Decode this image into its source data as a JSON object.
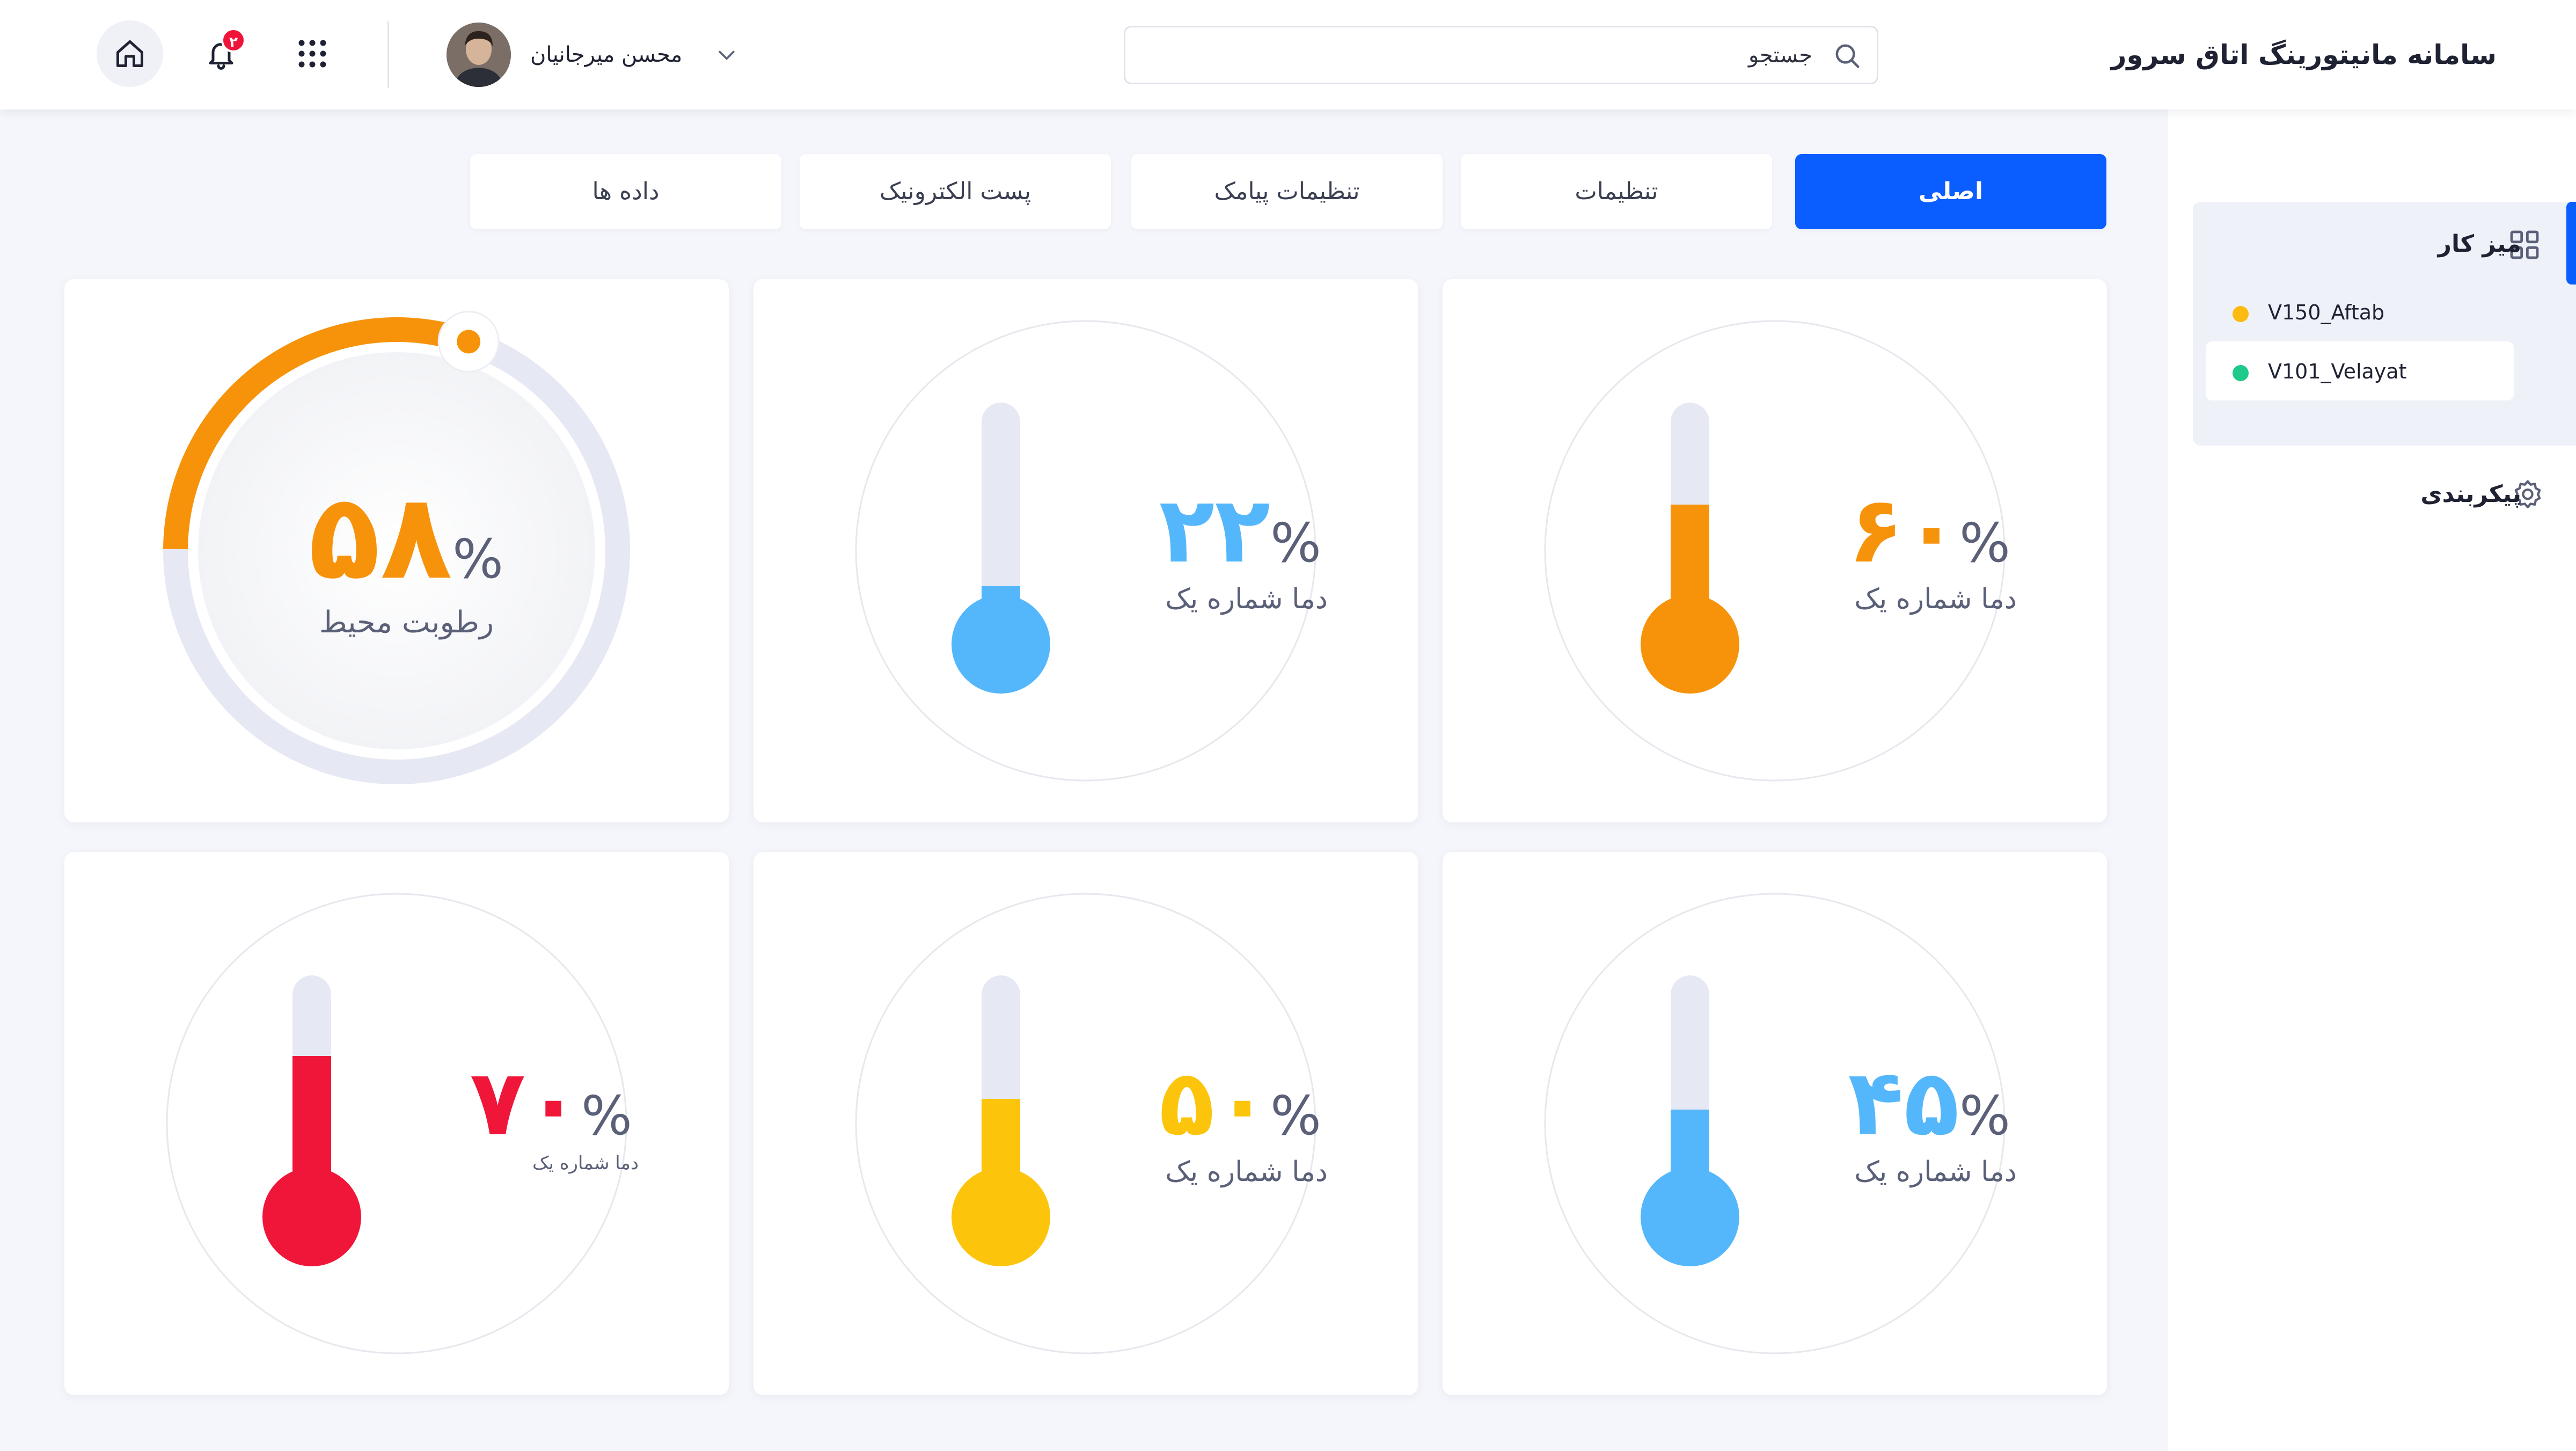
{
  "header": {
    "title": "سامانه مانیتورینگ اتاق سرور",
    "search_placeholder": "جستجو",
    "user_name": "محسن میرجانیان",
    "notification_count": "۲"
  },
  "sidebar": {
    "workspace_label": "میز کار",
    "devices": [
      {
        "label": "V150_Aftab",
        "status_color": "#fbbb10"
      },
      {
        "label": "V101_Velayat",
        "status_color": "#1fc98a"
      }
    ],
    "settings_label": "پیکربندی"
  },
  "tabs": [
    {
      "label": "اصلی",
      "active": true
    },
    {
      "label": "تنظیمات",
      "active": false
    },
    {
      "label": "تنظیمات پیامک",
      "active": false
    },
    {
      "label": "پست الکترونیک",
      "active": false
    },
    {
      "label": "داده ها",
      "active": false
    }
  ],
  "cards": [
    {
      "type": "thermometer",
      "value": "۶۰",
      "percent": 60,
      "unit": "%",
      "label": "دما شماره یک",
      "color": "#f7930a"
    },
    {
      "type": "thermometer",
      "value": "۲۲",
      "percent": 22,
      "unit": "%",
      "label": "دما شماره یک",
      "color": "#55b7fb"
    },
    {
      "type": "humidity",
      "value": "۵۸",
      "percent": 58,
      "unit": "%",
      "label": "رطوبت محیط",
      "color": "#f7930a"
    },
    {
      "type": "thermometer",
      "value": "۴۵",
      "percent": 45,
      "unit": "%",
      "label": "دما شماره یک",
      "color": "#55b7fb"
    },
    {
      "type": "thermometer",
      "value": "۵۰",
      "percent": 50,
      "unit": "%",
      "label": "دما شماره یک",
      "color": "#fcc50c"
    },
    {
      "type": "thermometer",
      "value": "۷۰",
      "percent": 70,
      "unit": "%",
      "label": "دما شماره یک",
      "color": "#f0163a"
    }
  ]
}
